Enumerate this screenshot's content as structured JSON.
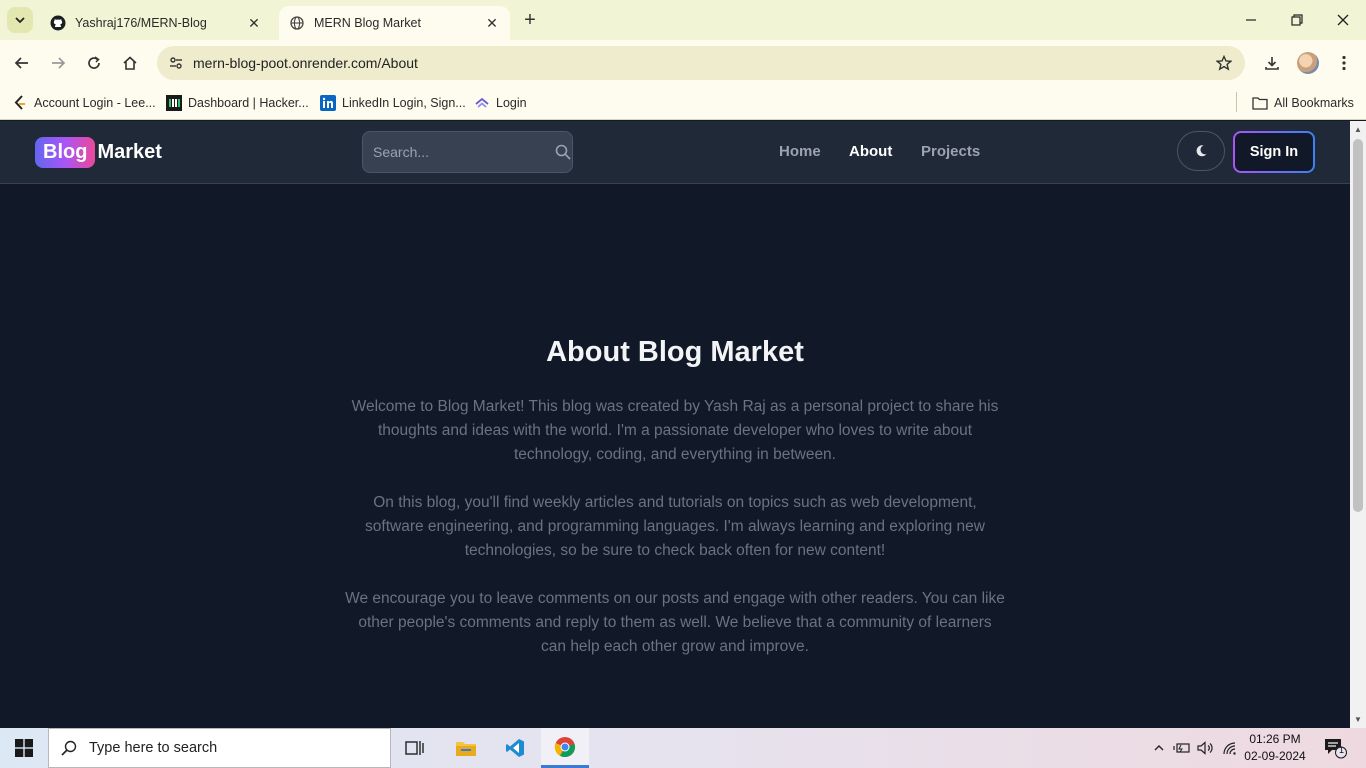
{
  "browser": {
    "tabs": [
      {
        "title": "Yashraj176/MERN-Blog",
        "favicon": "github-icon",
        "active": false
      },
      {
        "title": "MERN Blog Market",
        "favicon": "globe-icon",
        "active": true
      }
    ],
    "url": "mern-blog-poot.onrender.com/About",
    "bookmarks": [
      {
        "label": "Account Login - Lee...",
        "icon": "leetcode-icon"
      },
      {
        "label": "Dashboard | Hacker...",
        "icon": "hackerrank-icon"
      },
      {
        "label": "LinkedIn Login, Sign...",
        "icon": "linkedin-icon"
      },
      {
        "label": "Login",
        "icon": "codeium-icon"
      }
    ],
    "all_bookmarks_label": "All Bookmarks"
  },
  "site": {
    "logo_badge": "Blog",
    "logo_text": "Market",
    "search_placeholder": "Search...",
    "nav": [
      {
        "label": "Home",
        "active": false
      },
      {
        "label": "About",
        "active": true
      },
      {
        "label": "Projects",
        "active": false
      }
    ],
    "signin_label": "Sign In"
  },
  "about": {
    "title": "About Blog Market",
    "paragraphs": [
      "Welcome to Blog Market! This blog was created by Yash Raj as a personal project to share his thoughts and ideas with the world. I'm a passionate developer who loves to write about technology, coding, and everything in between.",
      "On this blog, you'll find weekly articles and tutorials on topics such as web development, software engineering, and programming languages. I'm always learning and exploring new technologies, so be sure to check back often for new content!",
      "We encourage you to leave comments on our posts and engage with other readers. You can like other people's comments and reply to them as well. We believe that a community of learners can help each other grow and improve."
    ]
  },
  "taskbar": {
    "search_text": "Type here to search",
    "time": "01:26 PM",
    "date": "02-09-2024",
    "notification_count": "1"
  },
  "colors": {
    "page_bg": "#111827",
    "header_bg": "#1f2937",
    "logo_gradient": [
      "#6366f1",
      "#a855f7",
      "#ec4899"
    ],
    "signin_gradient": [
      "#a855f7",
      "#3b82f6"
    ]
  }
}
